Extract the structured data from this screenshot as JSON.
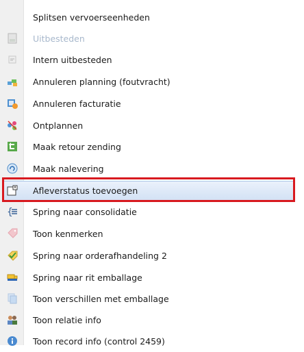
{
  "menu": {
    "items": [
      {
        "label": "Splitsen vervoerseenheden",
        "icon": "none-icon",
        "disabled": false
      },
      {
        "label": "Uitbesteden",
        "icon": "document-icon",
        "disabled": true
      },
      {
        "label": "Intern uitbesteden",
        "icon": "document-icon",
        "disabled": false
      },
      {
        "label": "Annuleren planning (foutvracht)",
        "icon": "cancel-planning-icon",
        "disabled": false
      },
      {
        "label": "Annuleren facturatie",
        "icon": "cancel-invoice-icon",
        "disabled": false
      },
      {
        "label": "Ontplannen",
        "icon": "unplan-icon",
        "disabled": false
      },
      {
        "label": "Maak retour zending",
        "icon": "return-icon",
        "disabled": false
      },
      {
        "label": "Maak nalevering",
        "icon": "redelivery-icon",
        "disabled": false
      },
      {
        "label": "Afleverstatus toevoegen",
        "icon": "new-document-icon",
        "disabled": false,
        "highlighted": true
      },
      {
        "label": "Spring naar consolidatie",
        "icon": "consolidation-icon",
        "disabled": false
      },
      {
        "label": "Toon kenmerken",
        "icon": "tag-icon",
        "disabled": false
      },
      {
        "label": "Spring naar orderafhandeling 2",
        "icon": "check-tag-icon",
        "disabled": false
      },
      {
        "label": "Spring naar rit emballage",
        "icon": "truck-icon",
        "disabled": false
      },
      {
        "label": "Toon verschillen met emballage",
        "icon": "pages-icon",
        "disabled": false
      },
      {
        "label": "Toon relatie info",
        "icon": "people-icon",
        "disabled": false
      },
      {
        "label": "Toon record info (control 2459)",
        "icon": "info-icon",
        "disabled": false
      }
    ]
  },
  "colors": {
    "highlight_outline": "#d8191f",
    "highlight_fill": "#d2e1f4",
    "icon_column": "#f0f0f0"
  }
}
